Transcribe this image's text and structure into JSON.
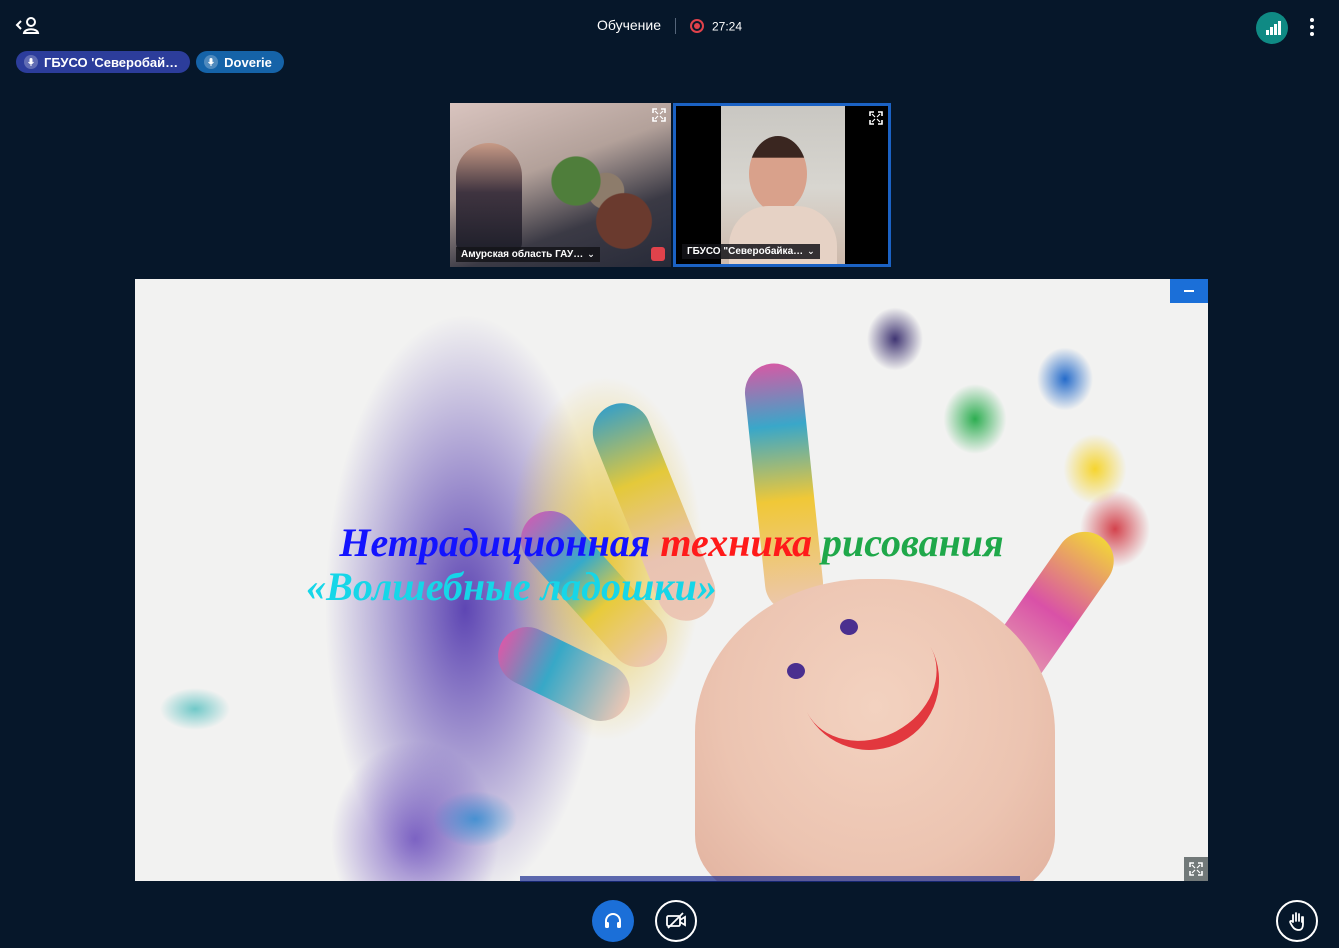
{
  "header": {
    "meeting_title": "Обучение",
    "recording_time": "27:24"
  },
  "talkers": [
    {
      "name": "ГБУСО 'Северобай…"
    },
    {
      "name": "Doverie"
    }
  ],
  "videos": [
    {
      "name": "Амурская область ГАУ…",
      "muted": true
    },
    {
      "name": "ГБУСО \"Северобайка…",
      "active": true
    }
  ],
  "presentation": {
    "title_word1": "Нетрадиционная",
    "title_word2": "техника",
    "title_word3": "рисования",
    "title_line2": "«Волшебные ладошки»"
  },
  "icons": {
    "user_list": "user-list-toggle-icon",
    "recording": "recording-indicator-icon",
    "connection": "connection-status-icon",
    "options": "more-options-icon",
    "mic": "microphone-icon",
    "fullscreen": "fullscreen-icon",
    "minimize": "minimize-presentation-icon",
    "audio": "headphones-icon",
    "video": "camera-off-icon",
    "raise_hand": "raise-hand-icon"
  },
  "colors": {
    "background": "#06172a",
    "accent": "#1b6fd8",
    "record": "#e0424b",
    "connection_good": "#0f8a84"
  }
}
